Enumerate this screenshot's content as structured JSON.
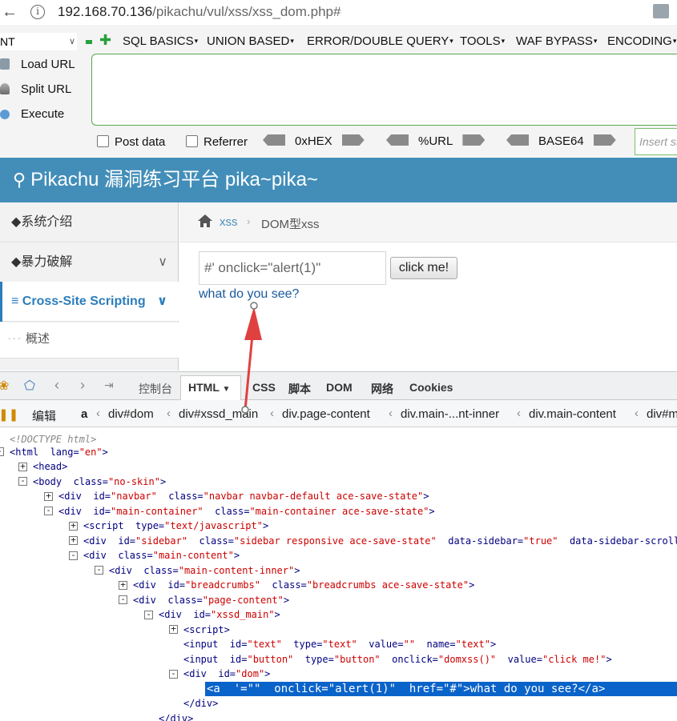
{
  "browser": {
    "url_host": "192.168.70.136",
    "url_path": "/pikachu/vul/xss/xss_dom.php#"
  },
  "hackbar": {
    "select_value": "NT",
    "menus": [
      "SQL BASICS",
      "UNION BASED",
      "ERROR/DOUBLE QUERY",
      "TOOLS",
      "WAF BYPASS",
      "ENCODING"
    ],
    "actions": [
      "Load URL",
      "Split URL",
      "Execute"
    ],
    "checkboxes": [
      "Post data",
      "Referrer"
    ],
    "encoders": [
      "0xHEX",
      "%URL",
      "BASE64"
    ],
    "insert_placeholder": "Insert string to replace"
  },
  "pikachu": {
    "title": "Pikachu 漏洞练习平台 pika~pika~",
    "sidebar": [
      {
        "label": "系统介绍"
      },
      {
        "label": "暴力破解"
      },
      {
        "label": "Cross-Site Scripting"
      }
    ],
    "sidebar_sub": "概述",
    "breadcrumb": [
      "xss",
      "DOM型xss"
    ],
    "input_value": "#' onclick=\"alert(1)\"",
    "button_label": "click me!",
    "link_text": "what do you see?"
  },
  "devtools": {
    "tabs": [
      "控制台",
      "HTML",
      "CSS",
      "脚本",
      "DOM",
      "网络",
      "Cookies"
    ],
    "edit_label": "编辑",
    "crumbs": [
      "a",
      "div#dom",
      "div#xssd_main",
      "div.page-content",
      "div.main-...nt-inner",
      "div.main-content",
      "div#m"
    ],
    "colors": {
      "selected_line": "#0a63c9",
      "attr_value": "#cc0000",
      "tag": "#000080"
    }
  }
}
